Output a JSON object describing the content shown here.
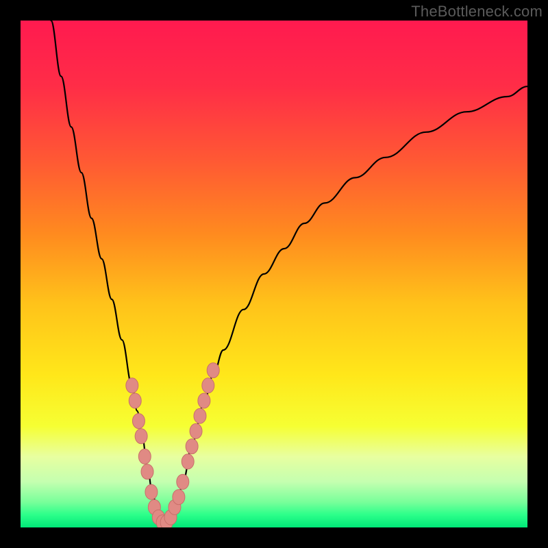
{
  "watermark": {
    "text": "TheBottleneck.com"
  },
  "colors": {
    "gradient_stops": [
      {
        "offset": 0.0,
        "color": "#ff1a4f"
      },
      {
        "offset": 0.13,
        "color": "#ff2d47"
      },
      {
        "offset": 0.28,
        "color": "#ff5a33"
      },
      {
        "offset": 0.42,
        "color": "#ff8a1f"
      },
      {
        "offset": 0.56,
        "color": "#ffc31a"
      },
      {
        "offset": 0.7,
        "color": "#ffe71a"
      },
      {
        "offset": 0.8,
        "color": "#f6ff33"
      },
      {
        "offset": 0.86,
        "color": "#e8ffa0"
      },
      {
        "offset": 0.91,
        "color": "#c4ffb0"
      },
      {
        "offset": 0.95,
        "color": "#78ff9a"
      },
      {
        "offset": 0.975,
        "color": "#2cff8a"
      },
      {
        "offset": 1.0,
        "color": "#00e878"
      }
    ],
    "curve": "#000000",
    "marker_fill": "#e08a84",
    "marker_stroke": "#c8706a"
  },
  "chart_data": {
    "type": "line",
    "title": "",
    "xlabel": "",
    "ylabel": "",
    "xlim": [
      0,
      100
    ],
    "ylim": [
      0,
      100
    ],
    "series": [
      {
        "name": "bottleneck-curve",
        "x": [
          6,
          8,
          10,
          12,
          14,
          16,
          18,
          20,
          22,
          23,
          24,
          25,
          26,
          27,
          28,
          29,
          30,
          31,
          32,
          34,
          36,
          38,
          40,
          44,
          48,
          52,
          56,
          60,
          66,
          72,
          80,
          88,
          96,
          100
        ],
        "y": [
          100,
          89,
          79,
          70,
          61,
          53,
          45,
          37,
          28,
          23,
          18,
          12,
          7,
          3,
          1,
          1,
          2,
          5,
          9,
          17,
          24,
          30,
          35,
          43,
          50,
          55,
          60,
          64,
          69,
          73,
          78,
          82,
          85,
          87
        ]
      }
    ],
    "markers": {
      "name": "highlighted-points",
      "points": [
        {
          "x": 22.0,
          "y": 28
        },
        {
          "x": 22.6,
          "y": 25
        },
        {
          "x": 23.3,
          "y": 21
        },
        {
          "x": 23.8,
          "y": 18
        },
        {
          "x": 24.5,
          "y": 14
        },
        {
          "x": 25.0,
          "y": 11
        },
        {
          "x": 25.8,
          "y": 7
        },
        {
          "x": 26.4,
          "y": 4
        },
        {
          "x": 27.2,
          "y": 2
        },
        {
          "x": 28.0,
          "y": 1
        },
        {
          "x": 28.8,
          "y": 1
        },
        {
          "x": 29.6,
          "y": 2
        },
        {
          "x": 30.4,
          "y": 4
        },
        {
          "x": 31.2,
          "y": 6
        },
        {
          "x": 32.0,
          "y": 9
        },
        {
          "x": 33.0,
          "y": 13
        },
        {
          "x": 33.8,
          "y": 16
        },
        {
          "x": 34.6,
          "y": 19
        },
        {
          "x": 35.4,
          "y": 22
        },
        {
          "x": 36.2,
          "y": 25
        },
        {
          "x": 37.0,
          "y": 28
        },
        {
          "x": 38.0,
          "y": 31
        }
      ]
    }
  }
}
